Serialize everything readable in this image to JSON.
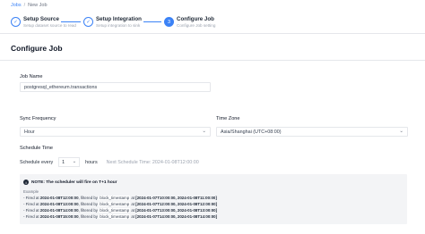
{
  "breadcrumb": {
    "root": "Jobs",
    "separator": "/",
    "current": "New Job"
  },
  "steps": [
    {
      "title": "Setup Source",
      "subtitle": "Setup dataset source to read",
      "status": "done",
      "marker": "✓"
    },
    {
      "title": "Setup Integration",
      "subtitle": "Setup integration to sink",
      "status": "done",
      "marker": "✓"
    },
    {
      "title": "Configure Job",
      "subtitle": "Configure Job setting",
      "status": "active",
      "marker": "3"
    }
  ],
  "page_title": "Configure Job",
  "job_name": {
    "label": "Job Name",
    "value": "postgresql_ethereum.transactions"
  },
  "sync_frequency": {
    "label": "Sync Frequency",
    "value": "Hour"
  },
  "time_zone": {
    "label": "Time Zone",
    "value": "Asia/Shanghai (UTC+08:00)"
  },
  "schedule": {
    "label": "Schedule Time",
    "prefix": "Schedule every",
    "value": "1",
    "unit": "hours",
    "next": "Next Schedule Time: 2024-01-08T12:00:00"
  },
  "note": {
    "title": "NOTE: The scheduler will fire on T+1 hour",
    "example_label": "Example",
    "lines": [
      {
        "a": "- Fired at ",
        "fired": "2024-01-08T12:00:00",
        "b": ", filtered by ",
        "field": "block_timestamp",
        "c": " at ",
        "range": "[2024-01-07T10:00:00, 2024-01-08T11:00:00]"
      },
      {
        "a": "- Fired at ",
        "fired": "2024-01-08T13:00:00",
        "b": ", filtered by ",
        "field": "block_timestamp",
        "c": " at ",
        "range": "[2024-01-07T12:00:00, 2024-01-08T12:00:00]"
      },
      {
        "a": "- Fired at ",
        "fired": "2024-01-08T14:00:00",
        "b": ", filtered by ",
        "field": "block_timestamp",
        "c": " at ",
        "range": "[2024-01-07T13:00:00, 2024-01-08T13:00:00]"
      },
      {
        "a": "- Fired at ",
        "fired": "2024-01-08T15:00:00",
        "b": ", filtered by ",
        "field": "block_timestamp",
        "c": " at ",
        "range": "[2024-01-07T14:00:00, 2024-01-08T14:00:00]"
      }
    ]
  },
  "colors": {
    "accent": "#3b82f6",
    "note_bg": "#f3f4f6"
  },
  "icons": {
    "step_done": "check-circle-icon",
    "select_arrow": "chevron-down-icon",
    "note": "info-icon"
  }
}
